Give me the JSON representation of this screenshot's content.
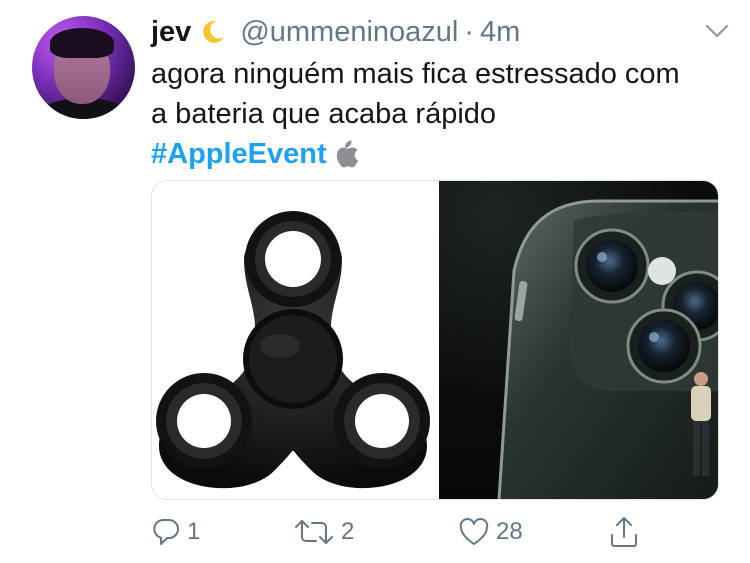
{
  "tweet": {
    "display_name": "jev",
    "handle": "@ummeninoazul",
    "separator": "·",
    "time": "4m",
    "text_line1": "agora ninguém mais fica estressado com",
    "text_line2": "a bateria que acaba rápido",
    "hashtag": "#AppleEvent"
  },
  "actions": {
    "reply_count": "1",
    "retweet_count": "2",
    "like_count": "28"
  },
  "icons": {
    "moon": "crescent-moon-emoji",
    "menu": "chevron-down-icon",
    "hashtag_emoji": "apple-logo-icon",
    "reply": "reply-icon",
    "retweet": "retweet-icon",
    "like": "heart-icon",
    "share": "share-icon"
  },
  "colors": {
    "link": "#1da1f2",
    "text": "#14171a",
    "secondary": "#657786"
  }
}
